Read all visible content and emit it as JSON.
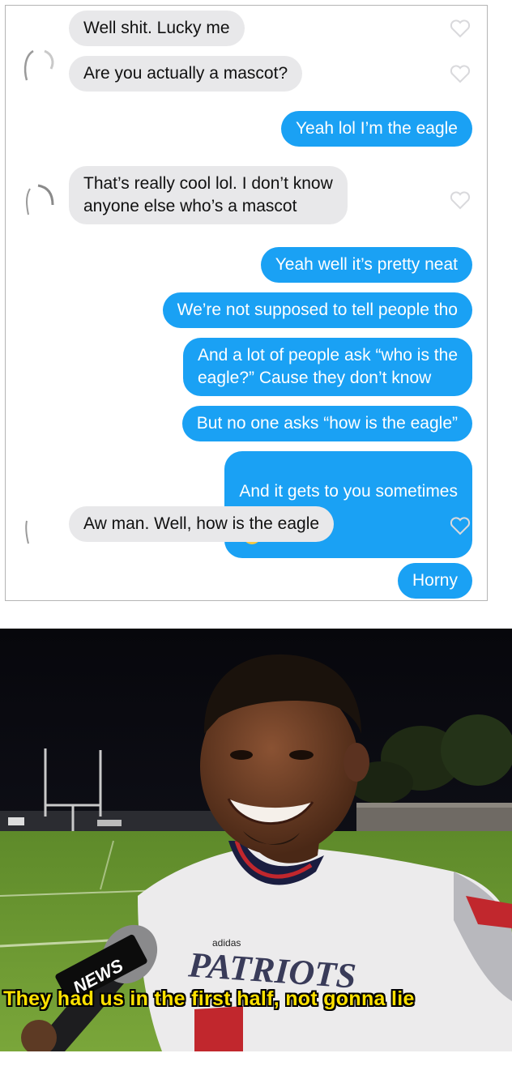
{
  "chat": {
    "messages": [
      {
        "side": "in",
        "text": "Well shit. Lucky me"
      },
      {
        "side": "in",
        "text": "Are you actually a mascot?"
      },
      {
        "side": "out",
        "text": "Yeah lol I’m the eagle"
      },
      {
        "side": "in",
        "text": "That’s really cool lol. I don’t know\nanyone else who’s a mascot"
      },
      {
        "side": "out",
        "text": "Yeah well it’s pretty neat"
      },
      {
        "side": "out",
        "text": "We’re not supposed to tell people tho"
      },
      {
        "side": "out",
        "text": "And a lot of people ask “who is the\neagle?” Cause they don’t know"
      },
      {
        "side": "out",
        "text": "But no one asks “how is the eagle”"
      },
      {
        "side": "out",
        "text": "And it gets to you sometimes",
        "emoji": "pensive-face-icon"
      },
      {
        "side": "in",
        "text": "Aw man. Well, how is the eagle"
      },
      {
        "side": "out",
        "text": "Horny"
      }
    ],
    "colors": {
      "incoming": "#e8e8ea",
      "outgoing": "#1aa1f4",
      "heart": "#d9d9dc"
    }
  },
  "meme": {
    "caption": "They had us in the first half, not gonna lie",
    "jersey_text": "PATRIOTS",
    "jersey_brand": "adidas",
    "mic_flag": "NEWS",
    "caption_color": "#ffe100"
  }
}
